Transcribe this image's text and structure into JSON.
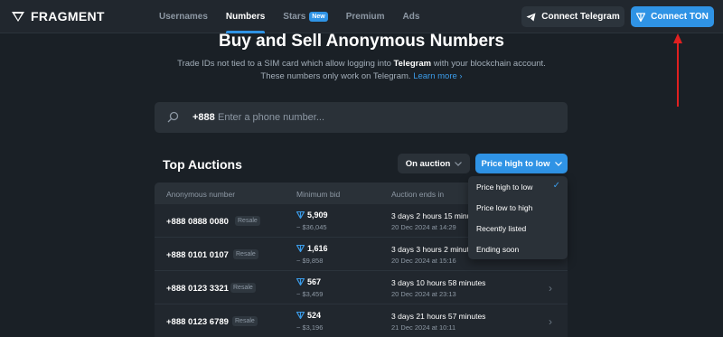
{
  "brand": {
    "name": "FRAGMENT"
  },
  "nav": [
    {
      "label": "Usernames",
      "active": false
    },
    {
      "label": "Numbers",
      "active": true
    },
    {
      "label": "Stars",
      "active": false,
      "badge": "New"
    },
    {
      "label": "Premium",
      "active": false
    },
    {
      "label": "Ads",
      "active": false
    }
  ],
  "header_buttons": {
    "telegram": "Connect Telegram",
    "ton": "Connect TON"
  },
  "hero": {
    "title": "Buy and Sell Anonymous Numbers",
    "line1_pre": "Trade IDs not tied to a SIM card which allow logging into ",
    "line1_bold": "Telegram",
    "line1_post": " with your blockchain account.",
    "line2": "These numbers only work on Telegram.",
    "learn_more": "Learn more ›"
  },
  "search": {
    "prefix": "+888",
    "placeholder": "Enter a phone number..."
  },
  "auctions": {
    "title": "Top Auctions",
    "filter_status": "On auction",
    "filter_sort": "Price high to low",
    "columns": [
      "Anonymous number",
      "Minimum bid",
      "Auction ends in"
    ],
    "rows": [
      {
        "number": "+888 0888 0080",
        "tag": "Resale",
        "bid": "5,909",
        "usd": "~ $36,045",
        "ends": "3 days 2 hours 15 minutes",
        "date": "20 Dec 2024 at 14:29"
      },
      {
        "number": "+888 0101 0107",
        "tag": "Resale",
        "bid": "1,616",
        "usd": "~ $9,858",
        "ends": "3 days 3 hours 2 minutes",
        "date": "20 Dec 2024 at 15:16"
      },
      {
        "number": "+888 0123 3321",
        "tag": "Resale",
        "bid": "567",
        "usd": "~ $3,459",
        "ends": "3 days 10 hours 58 minutes",
        "date": "20 Dec 2024 at 23:13"
      },
      {
        "number": "+888 0123 6789",
        "tag": "Resale",
        "bid": "524",
        "usd": "~ $3,196",
        "ends": "3 days 21 hours 57 minutes",
        "date": "21 Dec 2024 at 10:11"
      }
    ]
  },
  "sort_menu": {
    "items": [
      {
        "label": "Price high to low",
        "selected": true
      },
      {
        "label": "Price low to high",
        "selected": false
      },
      {
        "label": "Recently listed",
        "selected": false
      },
      {
        "label": "Ending soon",
        "selected": false
      }
    ]
  },
  "colors": {
    "accent": "#2f93e5",
    "annotation_arrow": "#e02020"
  }
}
